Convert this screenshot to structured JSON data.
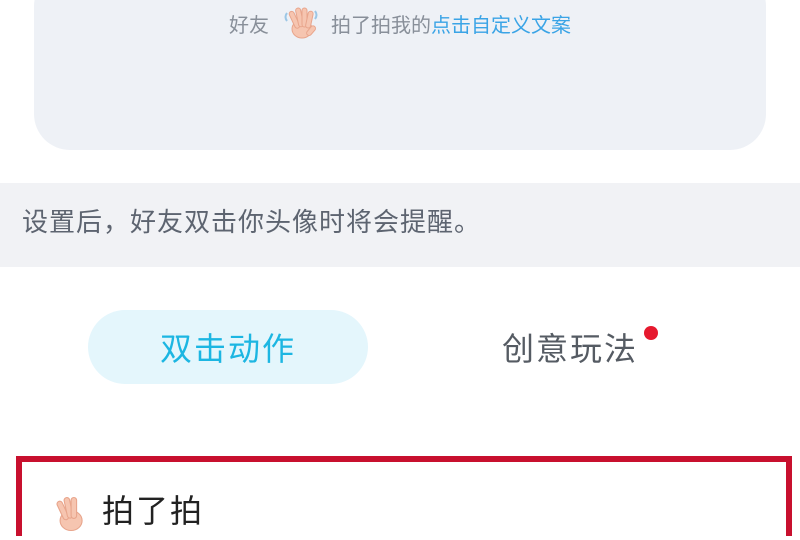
{
  "preview": {
    "prefix": "好友",
    "hand_icon": "waving-hand-icon",
    "middle": "拍了拍我的",
    "custom_text": "点击自定义文案"
  },
  "hint": {
    "text": "设置后，好友双击你头像时将会提醒。"
  },
  "tabs": [
    {
      "label": "双击动作",
      "active": true
    },
    {
      "label": "创意玩法",
      "active": false,
      "has_new_dot": true
    }
  ],
  "selected_item": {
    "icon": "waving-hand-icon",
    "label": "拍了拍"
  },
  "colors": {
    "accent": "#1cb6e2",
    "link": "#3aa4e6",
    "highlight_border": "#c8102e",
    "badge_dot": "#e6192e"
  }
}
